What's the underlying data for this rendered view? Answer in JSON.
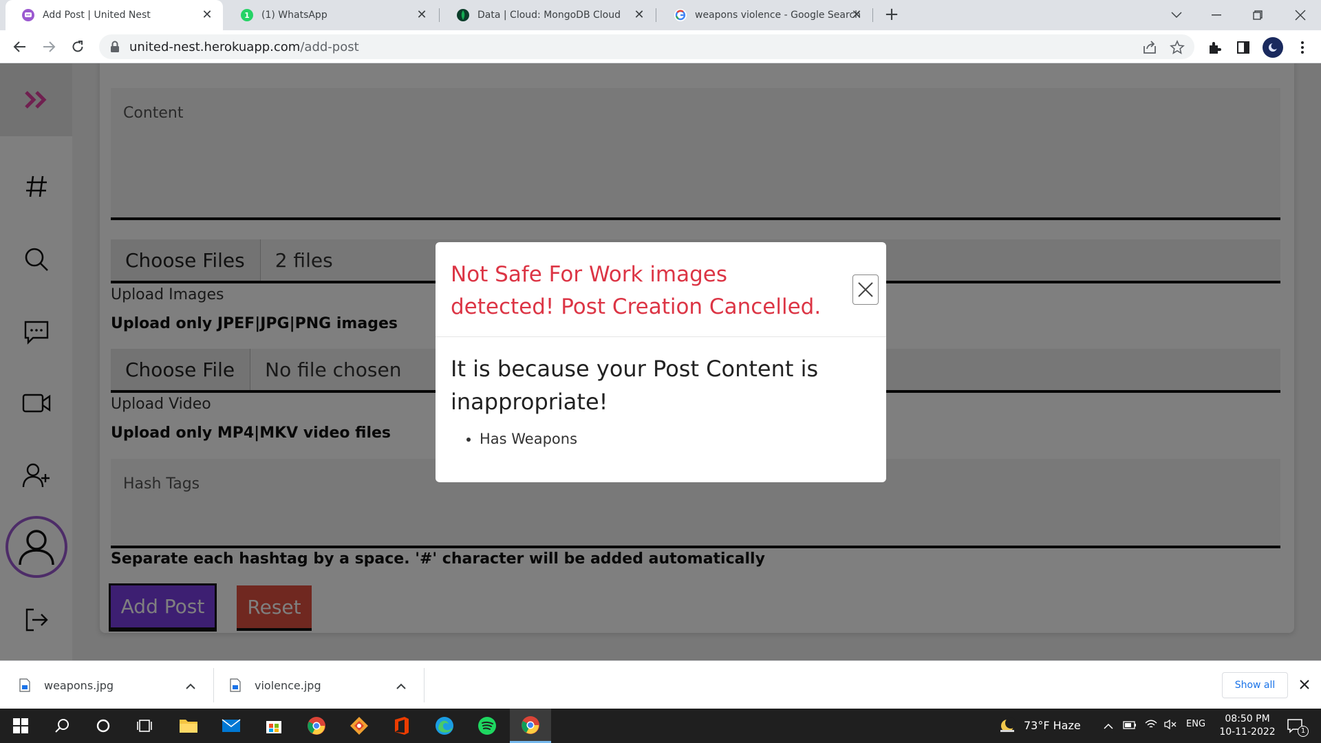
{
  "browser": {
    "tabs": [
      {
        "title": "Add Post | United Nest",
        "favicon": "united-nest-icon",
        "active": true
      },
      {
        "title": "(1) WhatsApp",
        "favicon": "whatsapp-icon",
        "active": false
      },
      {
        "title": "Data | Cloud: MongoDB Cloud",
        "favicon": "mongodb-icon",
        "active": false
      },
      {
        "title": "weapons violence - Google Search",
        "favicon": "google-icon",
        "active": false
      }
    ],
    "whatsapp_badge": "1",
    "url_host": "united-nest.herokuapp.com",
    "url_path": "/add-post"
  },
  "form": {
    "content_placeholder": "Content",
    "images_button": "Choose Files",
    "images_status": "2 files",
    "images_label": "Upload Images",
    "images_hint": "Upload only JPEF|JPG|PNG images",
    "video_button": "Choose File",
    "video_status": "No file chosen",
    "video_label": "Upload Video",
    "video_hint": "Upload only MP4|MKV video files",
    "hashtags_placeholder": "Hash Tags",
    "hashtags_hint": "Separate each hashtag by a space. '#' character will be added automatically",
    "add_button": "Add Post",
    "reset_button": "Reset"
  },
  "modal": {
    "title": "Not Safe For Work images detected! Post Creation Cancelled.",
    "message": "It is because your Post Content is inappropriate!",
    "reasons": [
      "Has Weapons"
    ]
  },
  "downloads": {
    "items": [
      {
        "name": "weapons.jpg"
      },
      {
        "name": "violence.jpg"
      }
    ],
    "show_all": "Show all"
  },
  "taskbar": {
    "weather": "73°F  Haze",
    "language": "ENG",
    "time": "08:50 PM",
    "date": "10-11-2022",
    "notification_count": "1"
  },
  "colors": {
    "brand_purple": "#7b3fe4",
    "reset_red": "#e05040",
    "alert_red": "#dc3545",
    "sidebar_logo": "#e040a0"
  }
}
